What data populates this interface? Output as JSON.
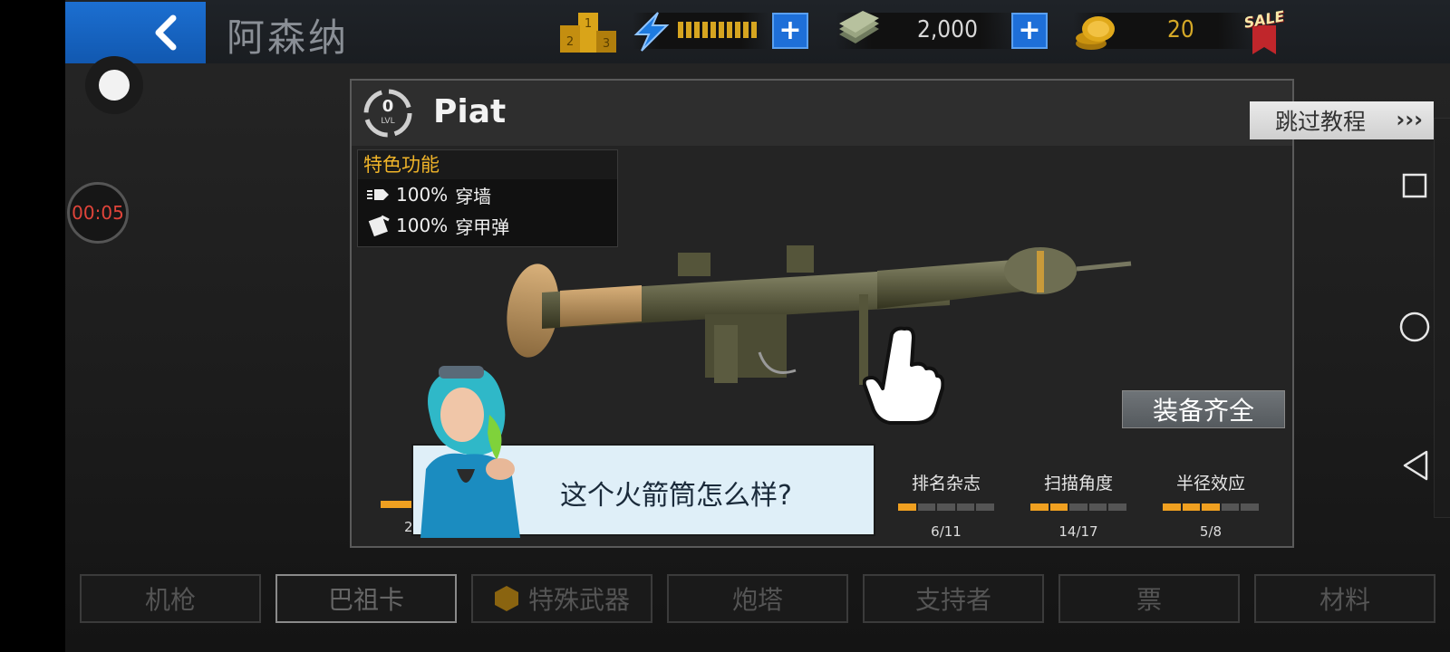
{
  "topbar": {
    "back_icon": "chevron-left-icon",
    "title": "阿森纳",
    "ranking_icon": "podium-icon",
    "energy_icon": "lightning-icon",
    "energy_plus": "+",
    "cash_icon": "cash-stack-icon",
    "cash_value": "2,000",
    "cash_plus": "+",
    "coins_icon": "gold-coins-icon",
    "coins_value": "20",
    "sale_badge": "SALE"
  },
  "recorder": {
    "timer": "00:05"
  },
  "panel": {
    "level_number": "0",
    "level_label": "LVL",
    "weapon_name": "Piat",
    "features_title": "特色功能",
    "features": [
      {
        "icon": "wall-pierce-icon",
        "value": "100%",
        "label": "穿墙"
      },
      {
        "icon": "armor-piercing-icon",
        "value": "100%",
        "label": "穿甲弹"
      }
    ],
    "equip_button": "装备齐全",
    "stats": [
      {
        "label": "排名杂志",
        "value": "6/11",
        "filled": 1,
        "segments": 5
      },
      {
        "label": "扫描角度",
        "value": "14/17",
        "filled": 2,
        "segments": 5
      },
      {
        "label": "半径效应",
        "value": "5/8",
        "filled": 3,
        "segments": 5
      }
    ],
    "hidden_stat_partial": "2"
  },
  "dialogue": {
    "text": "这个火箭筒怎么样?"
  },
  "tutorial": {
    "skip_label": "跳过教程",
    "skip_chevrons": "›››"
  },
  "tabs": [
    "机枪",
    "巴祖卡",
    "特殊武器",
    "炮塔",
    "支持者",
    "票",
    "材料"
  ],
  "colors": {
    "accent_blue": "#1e6fd8",
    "gold": "#f0b429",
    "bar_on": "#f0a020"
  }
}
